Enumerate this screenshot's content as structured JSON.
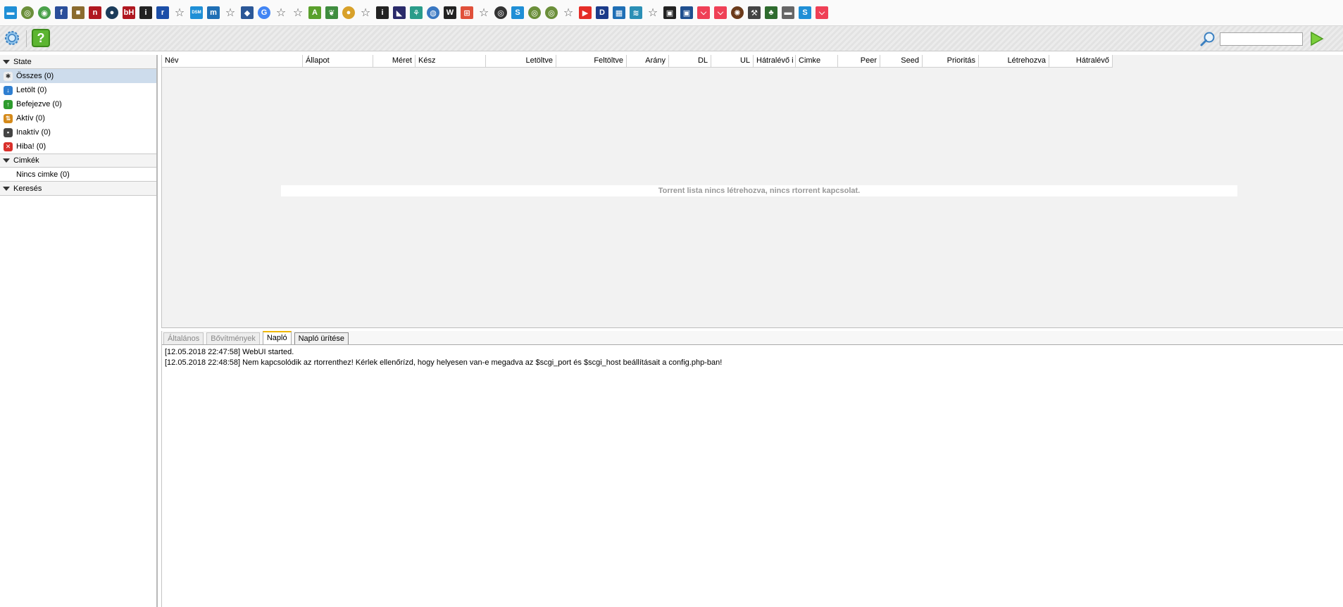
{
  "bookmarks": [
    {
      "icon": "chat-icon",
      "glyph": "▬",
      "color": "#1f8fd6",
      "type": "sq"
    },
    {
      "icon": "circle-app-icon",
      "glyph": "◎",
      "color": "#6b8f3a",
      "type": "circle"
    },
    {
      "icon": "frog-icon",
      "glyph": "◉",
      "color": "#4aa14a",
      "type": "circle"
    },
    {
      "icon": "f-logo-icon",
      "glyph": "f",
      "color": "#2a4e9a",
      "type": "sq"
    },
    {
      "icon": "wood-logo-icon",
      "glyph": "■",
      "color": "#8b6b2e",
      "type": "sq"
    },
    {
      "icon": "n-logo-icon",
      "glyph": "n",
      "color": "#b0171f",
      "type": "sq"
    },
    {
      "icon": "dark-circle-icon",
      "glyph": "●",
      "color": "#1b3b5a",
      "type": "circle"
    },
    {
      "icon": "bh-logo-icon",
      "glyph": "bH",
      "color": "#b0171f",
      "type": "sq"
    },
    {
      "icon": "i-logo-icon",
      "glyph": "i",
      "color": "#222222",
      "type": "sq"
    },
    {
      "icon": "r-logo-icon",
      "glyph": "r",
      "color": "#1b4ea8",
      "type": "sq"
    },
    {
      "icon": "star-icon",
      "glyph": "☆",
      "color": "",
      "type": "star"
    },
    {
      "icon": "dsm-logo-icon",
      "glyph": "DSM",
      "color": "#1f8fd6",
      "type": "sq"
    },
    {
      "icon": "m-logo-icon",
      "glyph": "m",
      "color": "#1f6fb5",
      "type": "sq"
    },
    {
      "icon": "star-icon",
      "glyph": "☆",
      "color": "",
      "type": "star"
    },
    {
      "icon": "cube-icon",
      "glyph": "◆",
      "color": "#2b5797",
      "type": "sq"
    },
    {
      "icon": "google-icon",
      "glyph": "G",
      "color": "#4285f4",
      "type": "circle"
    },
    {
      "icon": "star-icon",
      "glyph": "☆",
      "color": "",
      "type": "star"
    },
    {
      "icon": "star-icon",
      "glyph": "☆",
      "color": "",
      "type": "star"
    },
    {
      "icon": "a-logo-icon",
      "glyph": "A",
      "color": "#5aa02c",
      "type": "sq"
    },
    {
      "icon": "leaf-icon",
      "glyph": "❦",
      "color": "#3f8d3f",
      "type": "sq"
    },
    {
      "icon": "dot-icon",
      "glyph": "●",
      "color": "#d8a12a",
      "type": "circle"
    },
    {
      "icon": "star-icon",
      "glyph": "☆",
      "color": "",
      "type": "star"
    },
    {
      "icon": "i-logo-icon",
      "glyph": "i",
      "color": "#222222",
      "type": "sq"
    },
    {
      "icon": "night-icon",
      "glyph": "◣",
      "color": "#2a2a6a",
      "type": "sq"
    },
    {
      "icon": "network-icon",
      "glyph": "⚘",
      "color": "#2a9c8a",
      "type": "sq"
    },
    {
      "icon": "globe-icon",
      "glyph": "◍",
      "color": "#3a78c2",
      "type": "circle"
    },
    {
      "icon": "w-logo-icon",
      "glyph": "W",
      "color": "#222222",
      "type": "sq"
    },
    {
      "icon": "windows-icon",
      "glyph": "⊞",
      "color": "#e0503a",
      "type": "sq"
    },
    {
      "icon": "star-icon",
      "glyph": "☆",
      "color": "",
      "type": "star"
    },
    {
      "icon": "wheel-icon",
      "glyph": "◎",
      "color": "#333333",
      "type": "circle"
    },
    {
      "icon": "s-logo-icon",
      "glyph": "S",
      "color": "#1f8fd6",
      "type": "sq"
    },
    {
      "icon": "circle-app-icon",
      "glyph": "◎",
      "color": "#6b8f3a",
      "type": "circle"
    },
    {
      "icon": "circle-app-icon",
      "glyph": "◎",
      "color": "#6b8f3a",
      "type": "circle"
    },
    {
      "icon": "star-icon",
      "glyph": "☆",
      "color": "",
      "type": "star"
    },
    {
      "icon": "youtube-icon",
      "glyph": "▶",
      "color": "#e52d27",
      "type": "sq"
    },
    {
      "icon": "d-logo-icon",
      "glyph": "D",
      "color": "#1b3b8a",
      "type": "sq"
    },
    {
      "icon": "chart-icon",
      "glyph": "▦",
      "color": "#1f6fb5",
      "type": "sq"
    },
    {
      "icon": "wave-icon",
      "glyph": "≋",
      "color": "#2a8fb5",
      "type": "sq"
    },
    {
      "icon": "star-icon",
      "glyph": "☆",
      "color": "",
      "type": "star"
    },
    {
      "icon": "briefcase-icon",
      "glyph": "▣",
      "color": "#222222",
      "type": "sq"
    },
    {
      "icon": "briefcase-icon",
      "glyph": "▣",
      "color": "#1f4f8f",
      "type": "sq"
    },
    {
      "icon": "pocket-icon",
      "glyph": "⌵",
      "color": "#ef4056",
      "type": "sq"
    },
    {
      "icon": "pocket-icon",
      "glyph": "⌵",
      "color": "#ef4056",
      "type": "sq"
    },
    {
      "icon": "gear-icon",
      "glyph": "✺",
      "color": "#6b3a1a",
      "type": "circle"
    },
    {
      "icon": "hammer-icon",
      "glyph": "⚒",
      "color": "#444444",
      "type": "sq"
    },
    {
      "icon": "turtle-icon",
      "glyph": "♣",
      "color": "#2e6b2e",
      "type": "sq"
    },
    {
      "icon": "folder-icon",
      "glyph": "▬",
      "color": "#666666",
      "type": "sq"
    },
    {
      "icon": "s-logo-icon",
      "glyph": "S",
      "color": "#1f8fd6",
      "type": "sq"
    },
    {
      "icon": "pocket-icon",
      "glyph": "⌵",
      "color": "#ef4056",
      "type": "sq"
    }
  ],
  "toolbar": {
    "settings_icon": "gear-icon",
    "help_glyph": "?",
    "search_placeholder": "",
    "search_go_icon": "play-arrow-icon"
  },
  "sidebar": {
    "state_header": "State",
    "states": [
      {
        "label": "Összes (0)",
        "icon": "all-icon",
        "color": "#eeeeee",
        "glyph": "✱",
        "selected": true
      },
      {
        "label": "Letölt (0)",
        "icon": "download-icon",
        "color": "#2f7fd1",
        "glyph": "↓"
      },
      {
        "label": "Befejezve (0)",
        "icon": "completed-icon",
        "color": "#2e9c2e",
        "glyph": "↑"
      },
      {
        "label": "Aktív (0)",
        "icon": "active-icon",
        "color": "#d58a1a",
        "glyph": "⇅"
      },
      {
        "label": "Inaktív (0)",
        "icon": "inactive-icon",
        "color": "#444444",
        "glyph": "▪"
      },
      {
        "label": "Hiba! (0)",
        "icon": "error-icon",
        "color": "#d9302b",
        "glyph": "✕"
      }
    ],
    "labels_header": "Cimkék",
    "labels": [
      {
        "label": "Nincs cimke (0)"
      }
    ],
    "search_header": "Keresés"
  },
  "torrent_list": {
    "columns": [
      {
        "label": "Név",
        "align": "l",
        "w": 200
      },
      {
        "label": "Állapot",
        "align": "l",
        "w": 100
      },
      {
        "label": "Méret",
        "align": "r",
        "w": 60
      },
      {
        "label": "Kész",
        "align": "l",
        "w": 100
      },
      {
        "label": "Letöltve",
        "align": "r",
        "w": 100
      },
      {
        "label": "Feltöltve",
        "align": "r",
        "w": 100
      },
      {
        "label": "Arány",
        "align": "r",
        "w": 60
      },
      {
        "label": "DL",
        "align": "r",
        "w": 60
      },
      {
        "label": "UL",
        "align": "r",
        "w": 60
      },
      {
        "label": "Hátralévő i",
        "align": "l",
        "w": 60
      },
      {
        "label": "Cimke",
        "align": "l",
        "w": 60
      },
      {
        "label": "Peer",
        "align": "r",
        "w": 60
      },
      {
        "label": "Seed",
        "align": "r",
        "w": 60
      },
      {
        "label": "Prioritás",
        "align": "r",
        "w": 80
      },
      {
        "label": "Létrehozva",
        "align": "r",
        "w": 100
      },
      {
        "label": "Hátralévő",
        "align": "r",
        "w": 90
      }
    ],
    "empty_message": "Torrent lista nincs létrehozva, nincs rtorrent kapcsolat."
  },
  "bottom_panel": {
    "tabs": [
      {
        "label": "Általános",
        "active": false
      },
      {
        "label": "Bővítmények",
        "active": false
      },
      {
        "label": "Napló",
        "active": true
      }
    ],
    "clear_log_button": "Napló ürítése",
    "log": [
      "[12.05.2018 22:47:58] WebUI started.",
      "[12.05.2018 22:48:58] Nem kapcsolódik az rtorrenthez! Kérlek ellenőrízd, hogy helyesen van-e megadva az $scgi_port és $scgi_host beállításait a config.php-ban!"
    ]
  }
}
